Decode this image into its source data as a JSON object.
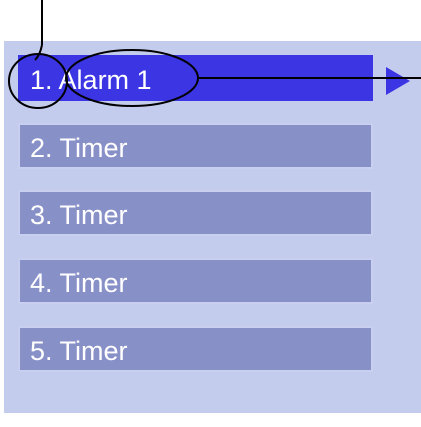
{
  "list": {
    "items": [
      {
        "number": "1.",
        "label": "Alarm 1",
        "selected": true
      },
      {
        "number": "2.",
        "label": "Timer",
        "selected": false
      },
      {
        "number": "3.",
        "label": "Timer",
        "selected": false
      },
      {
        "number": "4.",
        "label": "Timer",
        "selected": false
      },
      {
        "number": "5.",
        "label": "Timer",
        "selected": false
      }
    ]
  },
  "icons": {
    "submenu_arrow": "triangle-right-icon"
  },
  "colors": {
    "panel_background": "#c4ccee",
    "selected_item": "#3b35e4",
    "unselected_item": "#8890c8",
    "item_text": "#ffffff",
    "callout_lines": "#000000"
  }
}
